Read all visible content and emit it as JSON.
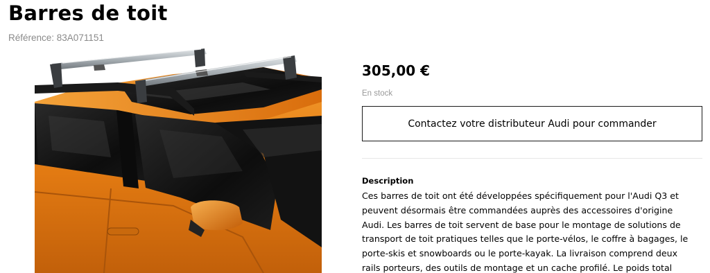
{
  "product": {
    "title": "Barres de toit",
    "reference": "Référence: 83A071151",
    "image_alt": "Audi Q3 orange avec barres de toit"
  },
  "purchase": {
    "price": "305,00 €",
    "stock_status": "En stock",
    "contact_button": "Contactez votre distributeur Audi pour commander"
  },
  "description": {
    "heading": "Description",
    "lines": [
      "Ces barres de toit ont été développées spécifiquement pour l'Audi Q3 et",
      "peuvent désormais être commandées auprès des accessoires d'origine",
      "Audi. Les barres de toit servent de base pour le montage de solutions de",
      "transport de toit pratiques telles que le porte-vélos, le coffre à bagages, le",
      "porte-skis et snowboards ou le porte-kayak. La livraison comprend deux",
      "rails porteurs, des outils de montage et un cache profilé. Le poids total"
    ]
  },
  "colors": {
    "car_orange": "#e07a12",
    "bar_silver": "#b9bfc4",
    "price_text": "#000000",
    "muted_text": "#8a8a8a"
  }
}
